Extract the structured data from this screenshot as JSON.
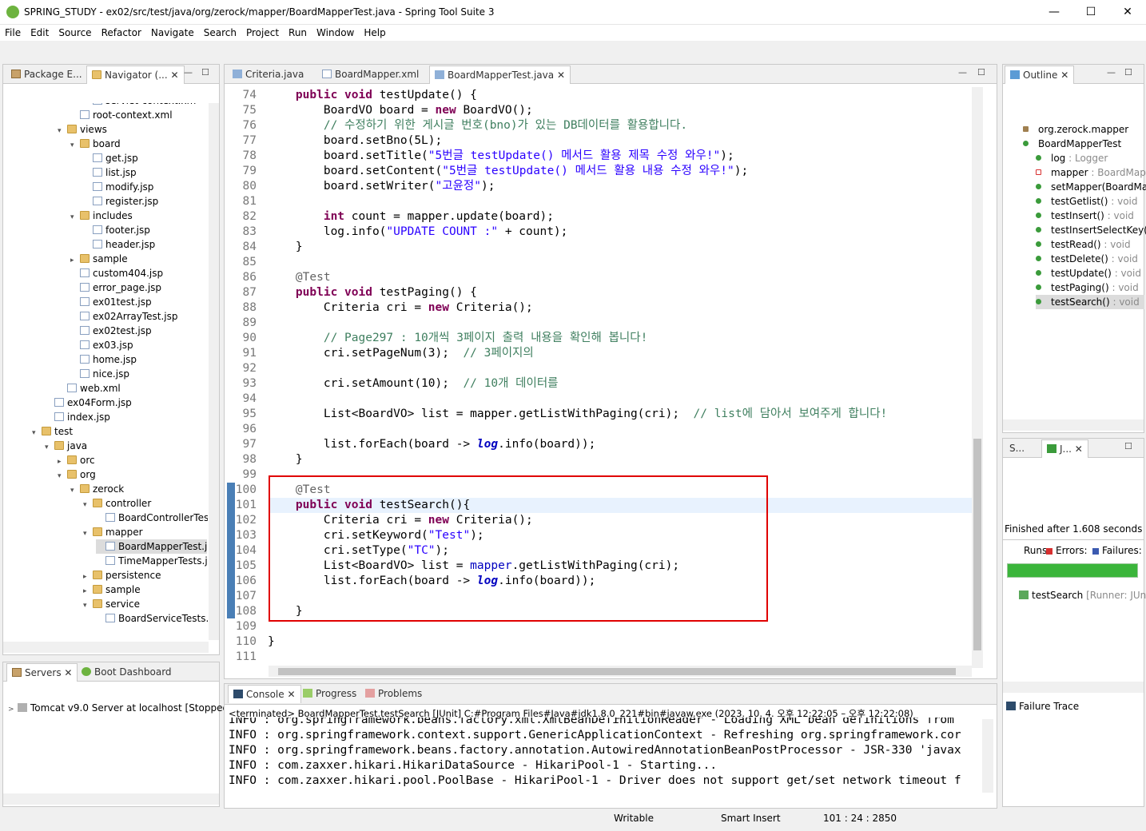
{
  "window": {
    "title": "SPRING_STUDY - ex02/src/test/java/org/zerock/mapper/BoardMapperTest.java - Spring Tool Suite 3",
    "minimize": "—",
    "maximize": "☐",
    "close": "✕"
  },
  "menu": [
    "File",
    "Edit",
    "Source",
    "Refactor",
    "Navigate",
    "Search",
    "Project",
    "Run",
    "Window",
    "Help"
  ],
  "left_tabs": {
    "package": "Package E...",
    "navigator": "Navigator (..."
  },
  "tree": [
    {
      "label": "servlet-context.xm",
      "depth": 4,
      "icon": "xml",
      "arrow": ""
    },
    {
      "label": "root-context.xml",
      "depth": 3,
      "icon": "xml",
      "arrow": ""
    },
    {
      "label": "views",
      "depth": 2,
      "icon": "folder",
      "arrow": "v"
    },
    {
      "label": "board",
      "depth": 3,
      "icon": "folder",
      "arrow": "v"
    },
    {
      "label": "get.jsp",
      "depth": 4,
      "icon": "file",
      "arrow": ""
    },
    {
      "label": "list.jsp",
      "depth": 4,
      "icon": "file",
      "arrow": ""
    },
    {
      "label": "modify.jsp",
      "depth": 4,
      "icon": "file",
      "arrow": ""
    },
    {
      "label": "register.jsp",
      "depth": 4,
      "icon": "file",
      "arrow": ""
    },
    {
      "label": "includes",
      "depth": 3,
      "icon": "folder",
      "arrow": "v"
    },
    {
      "label": "footer.jsp",
      "depth": 4,
      "icon": "file",
      "arrow": ""
    },
    {
      "label": "header.jsp",
      "depth": 4,
      "icon": "file",
      "arrow": ""
    },
    {
      "label": "sample",
      "depth": 3,
      "icon": "folder",
      "arrow": ">"
    },
    {
      "label": "custom404.jsp",
      "depth": 3,
      "icon": "file",
      "arrow": ""
    },
    {
      "label": "error_page.jsp",
      "depth": 3,
      "icon": "file",
      "arrow": ""
    },
    {
      "label": "ex01test.jsp",
      "depth": 3,
      "icon": "file",
      "arrow": ""
    },
    {
      "label": "ex02ArrayTest.jsp",
      "depth": 3,
      "icon": "file",
      "arrow": ""
    },
    {
      "label": "ex02test.jsp",
      "depth": 3,
      "icon": "file",
      "arrow": ""
    },
    {
      "label": "ex03.jsp",
      "depth": 3,
      "icon": "file",
      "arrow": ""
    },
    {
      "label": "home.jsp",
      "depth": 3,
      "icon": "file",
      "arrow": ""
    },
    {
      "label": "nice.jsp",
      "depth": 3,
      "icon": "file",
      "arrow": ""
    },
    {
      "label": "web.xml",
      "depth": 2,
      "icon": "xml",
      "arrow": ""
    },
    {
      "label": "ex04Form.jsp",
      "depth": 1,
      "icon": "file",
      "arrow": ""
    },
    {
      "label": "index.jsp",
      "depth": 1,
      "icon": "file",
      "arrow": ""
    },
    {
      "label": "test",
      "depth": 0,
      "icon": "folder",
      "arrow": "v"
    },
    {
      "label": "java",
      "depth": 1,
      "icon": "folder",
      "arrow": "v"
    },
    {
      "label": "orc",
      "depth": 2,
      "icon": "folder",
      "arrow": ">"
    },
    {
      "label": "org",
      "depth": 2,
      "icon": "folder",
      "arrow": "v"
    },
    {
      "label": "zerock",
      "depth": 3,
      "icon": "folder",
      "arrow": "v"
    },
    {
      "label": "controller",
      "depth": 4,
      "icon": "folder",
      "arrow": "v"
    },
    {
      "label": "BoardControllerTes",
      "depth": 5,
      "icon": "file",
      "arrow": ""
    },
    {
      "label": "mapper",
      "depth": 4,
      "icon": "folder",
      "arrow": "v"
    },
    {
      "label": "BoardMapperTest.j",
      "depth": 5,
      "icon": "file",
      "arrow": "",
      "selected": true
    },
    {
      "label": "TimeMapperTests.j",
      "depth": 5,
      "icon": "file",
      "arrow": ""
    },
    {
      "label": "persistence",
      "depth": 4,
      "icon": "folder",
      "arrow": ">"
    },
    {
      "label": "sample",
      "depth": 4,
      "icon": "folder",
      "arrow": ">"
    },
    {
      "label": "service",
      "depth": 4,
      "icon": "folder",
      "arrow": "v"
    },
    {
      "label": "BoardServiceTests.j",
      "depth": 5,
      "icon": "file",
      "arrow": ""
    }
  ],
  "servers": {
    "tab1": "Servers",
    "tab2": "Boot Dashboard",
    "item": "Tomcat v9.0 Server at localhost  [Stopped,"
  },
  "editor_tabs": [
    "Criteria.java",
    "BoardMapperTest.java"
  ],
  "editor_tab_xml": "BoardMapper.xml",
  "code": [
    {
      "n": "74",
      "t": "    <k>public</k> <k>void</k> testUpdate() {"
    },
    {
      "n": "75",
      "t": "        BoardVO board = <k>new</k> BoardVO();"
    },
    {
      "n": "76",
      "t": "        <c>// 수정하기 위한 게시글 번호(bno)가 있는 DB데이터를 활용합니다.</c>"
    },
    {
      "n": "77",
      "t": "        board.setBno(5L);"
    },
    {
      "n": "78",
      "t": "        board.setTitle(<s>\"5번글 testUpdate() 메서드 활용 제목 수정 와우!\"</s>);"
    },
    {
      "n": "79",
      "t": "        board.setContent(<s>\"5번글 testUpdate() 메서드 활용 내용 수정 와우!\"</s>);"
    },
    {
      "n": "80",
      "t": "        board.setWriter(<s>\"고윤정\"</s>);"
    },
    {
      "n": "81",
      "t": ""
    },
    {
      "n": "82",
      "t": "        <k>int</k> count = mapper.update(board);"
    },
    {
      "n": "83",
      "t": "        log.info(<s>\"UPDATE COUNT :\"</s> + count);"
    },
    {
      "n": "84",
      "t": "    }"
    },
    {
      "n": "85",
      "t": ""
    },
    {
      "n": "86",
      "t": "    <a>@Test</a>"
    },
    {
      "n": "87",
      "t": "    <k>public</k> <k>void</k> testPaging() {"
    },
    {
      "n": "88",
      "t": "        Criteria cri = <k>new</k> Criteria();"
    },
    {
      "n": "89",
      "t": ""
    },
    {
      "n": "90",
      "t": "        <c>// Page297 : 10개씩 3페이지 출력 내용을 확인해 봅니다!</c>"
    },
    {
      "n": "91",
      "t": "        cri.setPageNum(3);  <c>// 3페이지의</c>"
    },
    {
      "n": "92",
      "t": ""
    },
    {
      "n": "93",
      "t": "        cri.setAmount(10);  <c>// 10개 데이터를</c>"
    },
    {
      "n": "94",
      "t": ""
    },
    {
      "n": "95",
      "t": "        List&lt;BoardVO&gt; list = mapper.getListWithPaging(cri);  <c>// list에 담아서 보여주게 합니다!</c>"
    },
    {
      "n": "96",
      "t": ""
    },
    {
      "n": "97",
      "t": "        list.forEach(board -> <i>log</i>.info(board));"
    },
    {
      "n": "98",
      "t": "    }"
    },
    {
      "n": "99",
      "t": ""
    },
    {
      "n": "100",
      "t": "    <a>@Test</a>"
    },
    {
      "n": "101",
      "t": "    <k>public</k> <k>void</k> testSearch(){"
    },
    {
      "n": "102",
      "t": "        Criteria cri = <k>new</k> Criteria();"
    },
    {
      "n": "103",
      "t": "        cri.setKeyword(<s>\"Test\"</s>);"
    },
    {
      "n": "104",
      "t": "        cri.setType(<s>\"TC\"</s>);"
    },
    {
      "n": "105",
      "t": "        List&lt;BoardVO&gt; list = <f>mapper</f>.getListWithPaging(cri);"
    },
    {
      "n": "106",
      "t": "        list.forEach(board -> <i>log</i>.info(board));"
    },
    {
      "n": "107",
      "t": ""
    },
    {
      "n": "108",
      "t": "    }"
    },
    {
      "n": "109",
      "t": ""
    },
    {
      "n": "110",
      "t": "}"
    },
    {
      "n": "111",
      "t": ""
    }
  ],
  "console": {
    "tabs": [
      "Console",
      "Progress",
      "Problems"
    ],
    "terminated": "<terminated> BoardMapperTest.testSearch [JUnit] C:#Program Files#Java#jdk1.8.0_221#bin#javaw.exe  (2023. 10. 4. 오후 12:22:05 – 오후 12:22:08)",
    "lines": [
      "INFO : org.springframework.beans.factory.xml.XmlBeanDefinitionReader - Loading XML bean definitions from",
      "INFO : org.springframework.context.support.GenericApplicationContext - Refreshing org.springframework.cor",
      "INFO : org.springframework.beans.factory.annotation.AutowiredAnnotationBeanPostProcessor - JSR-330 'javax",
      "INFO : com.zaxxer.hikari.HikariDataSource - HikariPool-1 - Starting...",
      "INFO : com.zaxxer.hikari.pool.PoolBase - HikariPool-1 - Driver does not support get/set network timeout f"
    ]
  },
  "outline": {
    "tab": "Outline",
    "items": [
      {
        "name": "org.zerock.mapper",
        "type": "",
        "depth": 0
      },
      {
        "name": "BoardMapperTest",
        "type": "",
        "depth": 0
      },
      {
        "name": "log",
        "type": " : Logger",
        "depth": 1
      },
      {
        "name": "mapper",
        "type": " : BoardMap",
        "depth": 1
      },
      {
        "name": "setMapper(BoardMa",
        "type": "",
        "depth": 1
      },
      {
        "name": "testGetlist()",
        "type": " : void",
        "depth": 1
      },
      {
        "name": "testInsert()",
        "type": " : void",
        "depth": 1
      },
      {
        "name": "testInsertSelectKey()",
        "type": "",
        "depth": 1
      },
      {
        "name": "testRead()",
        "type": " : void",
        "depth": 1
      },
      {
        "name": "testDelete()",
        "type": " : void",
        "depth": 1
      },
      {
        "name": "testUpdate()",
        "type": " : void",
        "depth": 1
      },
      {
        "name": "testPaging()",
        "type": " : void",
        "depth": 1
      },
      {
        "name": "testSearch()",
        "type": " : void",
        "depth": 1,
        "selected": true
      }
    ]
  },
  "junit": {
    "tab1": "S...",
    "tab2": "J...",
    "finished": "Finished after 1.608 seconds",
    "runs": "Runs:",
    "errors": "Errors:",
    "failures": "Failures:",
    "progress": 1,
    "test": "testSearch",
    "runner": " [Runner: JUnit",
    "failure_trace": "Failure Trace"
  },
  "status": {
    "writable": "Writable",
    "insert": "Smart Insert",
    "position": "101 : 24 : 2850"
  },
  "colors": {
    "accent": "#3b9b3b",
    "highlight_box": "#e00000",
    "keyword": "#7f0055",
    "string": "#2a00ff",
    "comment": "#3f7f5f"
  }
}
